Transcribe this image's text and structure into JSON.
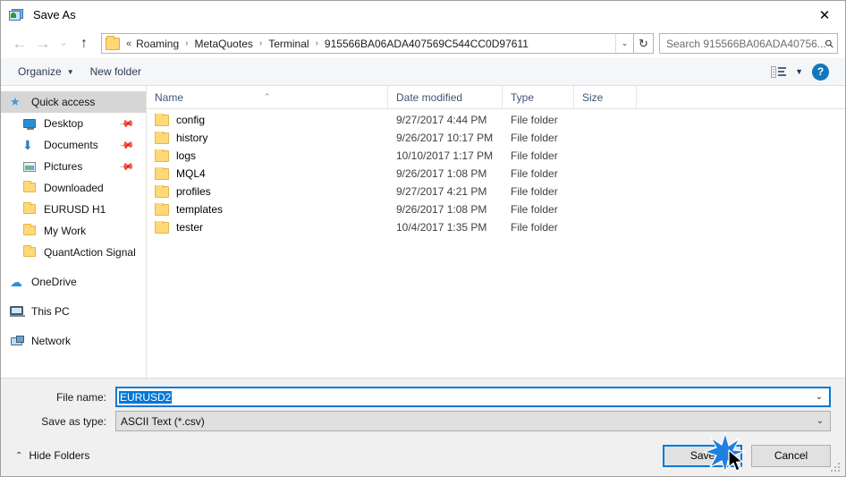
{
  "window": {
    "title": "Save As",
    "icon": "save-as-icon",
    "close_label": "✕"
  },
  "nav": {
    "back_icon": "←",
    "forward_icon": "→",
    "recent_icon": "⌄",
    "up_icon": "↑",
    "refresh_icon": "↻",
    "breadcrumb_prefix": "«",
    "breadcrumbs": [
      "Roaming",
      "MetaQuotes",
      "Terminal",
      "915566BA06ADA407569C544CC0D97611"
    ],
    "separator": "›",
    "dropdown_icon": "⌄"
  },
  "search": {
    "placeholder": "Search 915566BA06ADA40756...",
    "icon": "search-icon"
  },
  "toolbar": {
    "organize_label": "Organize",
    "organize_caret": "▼",
    "new_folder_label": "New folder",
    "view_caret": "▼",
    "help_label": "?"
  },
  "sidebar": {
    "items": [
      {
        "label": "Quick access",
        "icon": "star-icon",
        "level": 0,
        "selected": true,
        "pinned": false
      },
      {
        "label": "Desktop",
        "icon": "desktop-icon",
        "level": 1,
        "selected": false,
        "pinned": true
      },
      {
        "label": "Documents",
        "icon": "documents-icon",
        "level": 1,
        "selected": false,
        "pinned": true
      },
      {
        "label": "Pictures",
        "icon": "pictures-icon",
        "level": 1,
        "selected": false,
        "pinned": true
      },
      {
        "label": "Downloaded",
        "icon": "folder-icon",
        "level": 1,
        "selected": false,
        "pinned": false
      },
      {
        "label": "EURUSD H1",
        "icon": "folder-icon",
        "level": 1,
        "selected": false,
        "pinned": false
      },
      {
        "label": "My Work",
        "icon": "folder-icon",
        "level": 1,
        "selected": false,
        "pinned": false
      },
      {
        "label": "QuantAction Signal",
        "icon": "folder-icon",
        "level": 1,
        "selected": false,
        "pinned": false
      },
      {
        "label": "OneDrive",
        "icon": "onedrive-icon",
        "level": 0,
        "selected": false,
        "pinned": false,
        "group_top": true
      },
      {
        "label": "This PC",
        "icon": "this-pc-icon",
        "level": 0,
        "selected": false,
        "pinned": false,
        "group_top": true
      },
      {
        "label": "Network",
        "icon": "network-icon",
        "level": 0,
        "selected": false,
        "pinned": false,
        "group_top": true
      }
    ],
    "pin_icon": "\u0001"
  },
  "filelist": {
    "columns": [
      "Name",
      "Date modified",
      "Type",
      "Size"
    ],
    "sort_indicator": "⌃",
    "rows": [
      {
        "name": "config",
        "date": "9/27/2017 4:44 PM",
        "type": "File folder",
        "size": ""
      },
      {
        "name": "history",
        "date": "9/26/2017 10:17 PM",
        "type": "File folder",
        "size": ""
      },
      {
        "name": "logs",
        "date": "10/10/2017 1:17 PM",
        "type": "File folder",
        "size": ""
      },
      {
        "name": "MQL4",
        "date": "9/26/2017 1:08 PM",
        "type": "File folder",
        "size": ""
      },
      {
        "name": "profiles",
        "date": "9/27/2017 4:21 PM",
        "type": "File folder",
        "size": ""
      },
      {
        "name": "templates",
        "date": "9/26/2017 1:08 PM",
        "type": "File folder",
        "size": ""
      },
      {
        "name": "tester",
        "date": "10/4/2017 1:35 PM",
        "type": "File folder",
        "size": ""
      }
    ]
  },
  "form": {
    "filename_label": "File name:",
    "filename_value": "EURUSD2",
    "filetype_label": "Save as type:",
    "filetype_value": "ASCII Text (*.csv)",
    "caret_icon": "⌄"
  },
  "footer": {
    "hide_folders_label": "Hide Folders",
    "hide_folders_caret": "⌃",
    "save_label": "Save",
    "cancel_label": "Cancel"
  },
  "colors": {
    "accent": "#0078d7",
    "folder": "#ffd878",
    "selection": "#d6d6d6",
    "column_header_text": "#3f5676",
    "help_blue": "#1277bc"
  }
}
